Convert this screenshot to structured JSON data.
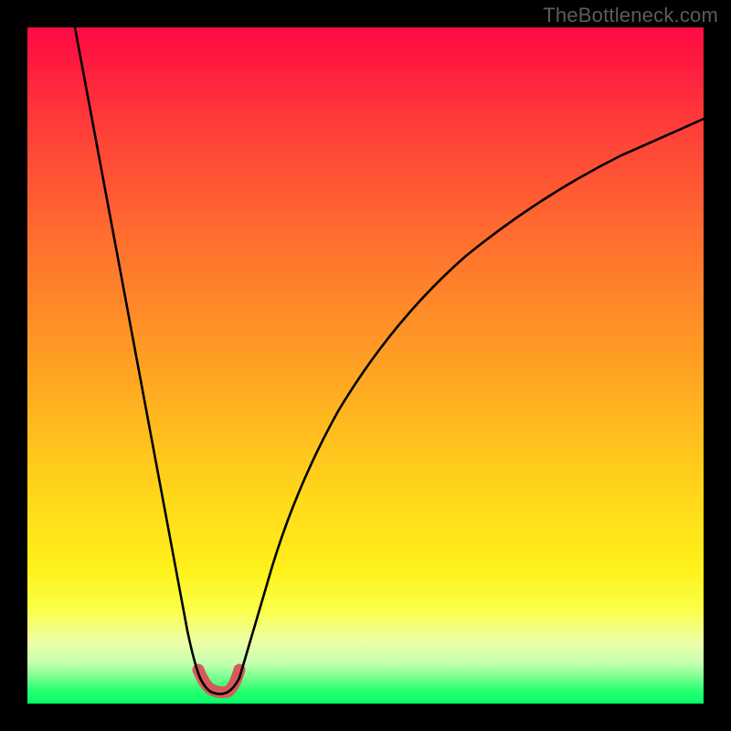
{
  "attribution": "TheBottleneck.com",
  "colors": {
    "frame": "#000000",
    "curve_stroke": "#000000",
    "highlight_stroke": "#d65a5a",
    "gradient_stops": [
      {
        "offset": 0.0,
        "color": "#ff0b47"
      },
      {
        "offset": 0.05,
        "color": "#ff1a3f"
      },
      {
        "offset": 0.15,
        "color": "#ff3f39"
      },
      {
        "offset": 0.3,
        "color": "#ff6b30"
      },
      {
        "offset": 0.45,
        "color": "#ff9326"
      },
      {
        "offset": 0.58,
        "color": "#ffb81f"
      },
      {
        "offset": 0.7,
        "color": "#ffd91a"
      },
      {
        "offset": 0.8,
        "color": "#fff119"
      },
      {
        "offset": 0.86,
        "color": "#fbff48"
      },
      {
        "offset": 0.91,
        "color": "#edffa9"
      },
      {
        "offset": 0.94,
        "color": "#c6ffb0"
      },
      {
        "offset": 0.96,
        "color": "#7fff91"
      },
      {
        "offset": 0.98,
        "color": "#2bff72"
      },
      {
        "offset": 1.0,
        "color": "#00ff66"
      }
    ]
  },
  "chart_data": {
    "type": "line",
    "title": "",
    "xlabel": "",
    "ylabel": "",
    "xlim": [
      0,
      100
    ],
    "ylim": [
      0,
      100
    ],
    "note": "x/y are percentage of plot area; y=0 at bottom. Values read from pixels (approximate).",
    "series": [
      {
        "name": "left-arm",
        "values": [
          {
            "x": 7.0,
            "y": 100.0
          },
          {
            "x": 9.0,
            "y": 91.0
          },
          {
            "x": 11.0,
            "y": 82.0
          },
          {
            "x": 13.0,
            "y": 72.0
          },
          {
            "x": 15.0,
            "y": 62.0
          },
          {
            "x": 17.0,
            "y": 52.0
          },
          {
            "x": 19.0,
            "y": 42.0
          },
          {
            "x": 21.0,
            "y": 31.0
          },
          {
            "x": 23.0,
            "y": 20.0
          },
          {
            "x": 24.5,
            "y": 11.0
          },
          {
            "x": 25.5,
            "y": 6.0
          },
          {
            "x": 26.3,
            "y": 3.5
          }
        ]
      },
      {
        "name": "trough",
        "values": [
          {
            "x": 26.3,
            "y": 3.5
          },
          {
            "x": 27.2,
            "y": 2.2
          },
          {
            "x": 28.3,
            "y": 1.6
          },
          {
            "x": 29.5,
            "y": 1.6
          },
          {
            "x": 30.6,
            "y": 2.2
          },
          {
            "x": 31.4,
            "y": 3.5
          }
        ]
      },
      {
        "name": "right-arm",
        "values": [
          {
            "x": 31.4,
            "y": 3.5
          },
          {
            "x": 33.0,
            "y": 9.0
          },
          {
            "x": 35.0,
            "y": 17.0
          },
          {
            "x": 38.0,
            "y": 27.0
          },
          {
            "x": 42.0,
            "y": 37.0
          },
          {
            "x": 47.0,
            "y": 47.0
          },
          {
            "x": 53.0,
            "y": 56.0
          },
          {
            "x": 60.0,
            "y": 64.0
          },
          {
            "x": 68.0,
            "y": 71.0
          },
          {
            "x": 77.0,
            "y": 77.0
          },
          {
            "x": 86.0,
            "y": 81.5
          },
          {
            "x": 95.0,
            "y": 85.0
          },
          {
            "x": 100.0,
            "y": 86.5
          }
        ]
      }
    ],
    "highlight_segment": {
      "series": "trough",
      "note": "thicker salmon-colored emphasis near the minimum",
      "x_range": [
        25.3,
        32.4
      ]
    }
  }
}
